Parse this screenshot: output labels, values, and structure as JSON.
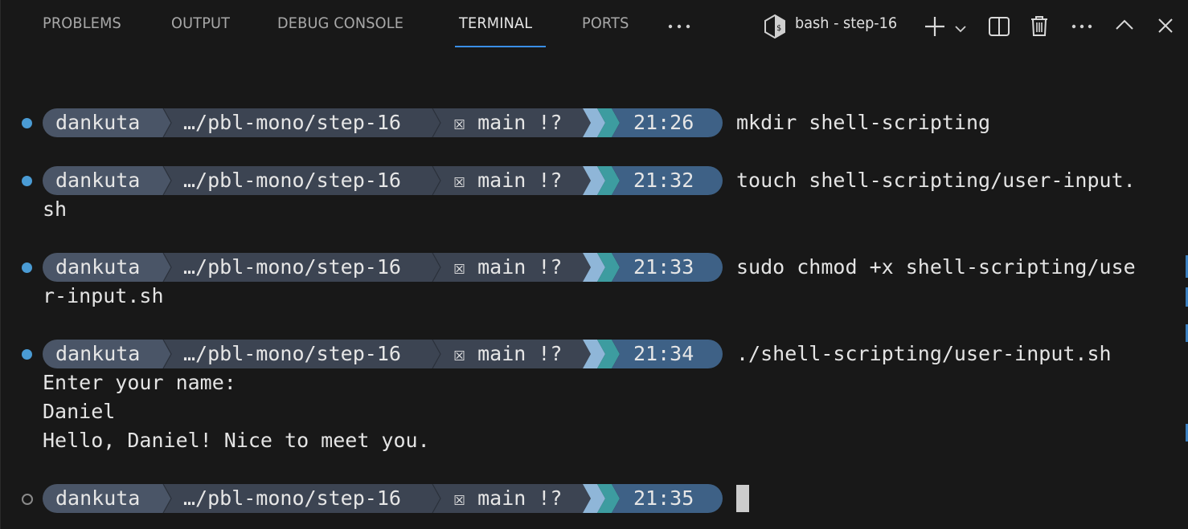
{
  "tabs": [
    {
      "label": "PROBLEMS"
    },
    {
      "label": "OUTPUT"
    },
    {
      "label": "DEBUG CONSOLE"
    },
    {
      "label": "TERMINAL",
      "active": true
    },
    {
      "label": "PORTS"
    }
  ],
  "toolbar": {
    "terminal_name": "bash - step-16",
    "icons": [
      "more-icon",
      "terminal-icon",
      "plus-icon",
      "chevron-down-icon",
      "split-icon",
      "trash-icon",
      "more-icon",
      "chevron-up-icon",
      "close-icon"
    ]
  },
  "prompt": {
    "user": "dankuta",
    "path": "…/pbl-mono/step-16",
    "git": "☒ main !?"
  },
  "colors": {
    "user_bg": "#4a5567",
    "path_bg": "#3c4452",
    "git_bg": "#3c4452",
    "time_bg": "#3e6186",
    "chevron_light": "#8fb6d8",
    "chevron_teal": "#3d9ca0",
    "success_dot": "#4a9bd4",
    "accent": "#3a8ee6"
  },
  "entries": [
    {
      "status": "success",
      "time": "21:26",
      "command": "mkdir shell-scripting",
      "output": []
    },
    {
      "status": "success",
      "time": "21:32",
      "command": "touch shell-scripting/user-input.",
      "output": [
        "sh"
      ]
    },
    {
      "status": "success",
      "time": "21:33",
      "command": "sudo chmod +x shell-scripting/use",
      "output": [
        "r-input.sh"
      ]
    },
    {
      "status": "success",
      "time": "21:34",
      "command": "./shell-scripting/user-input.sh",
      "output": [
        "Enter your name:",
        "Daniel",
        "Hello, Daniel! Nice to meet you."
      ]
    },
    {
      "status": "pending",
      "time": "21:35",
      "command": "",
      "output": []
    }
  ]
}
